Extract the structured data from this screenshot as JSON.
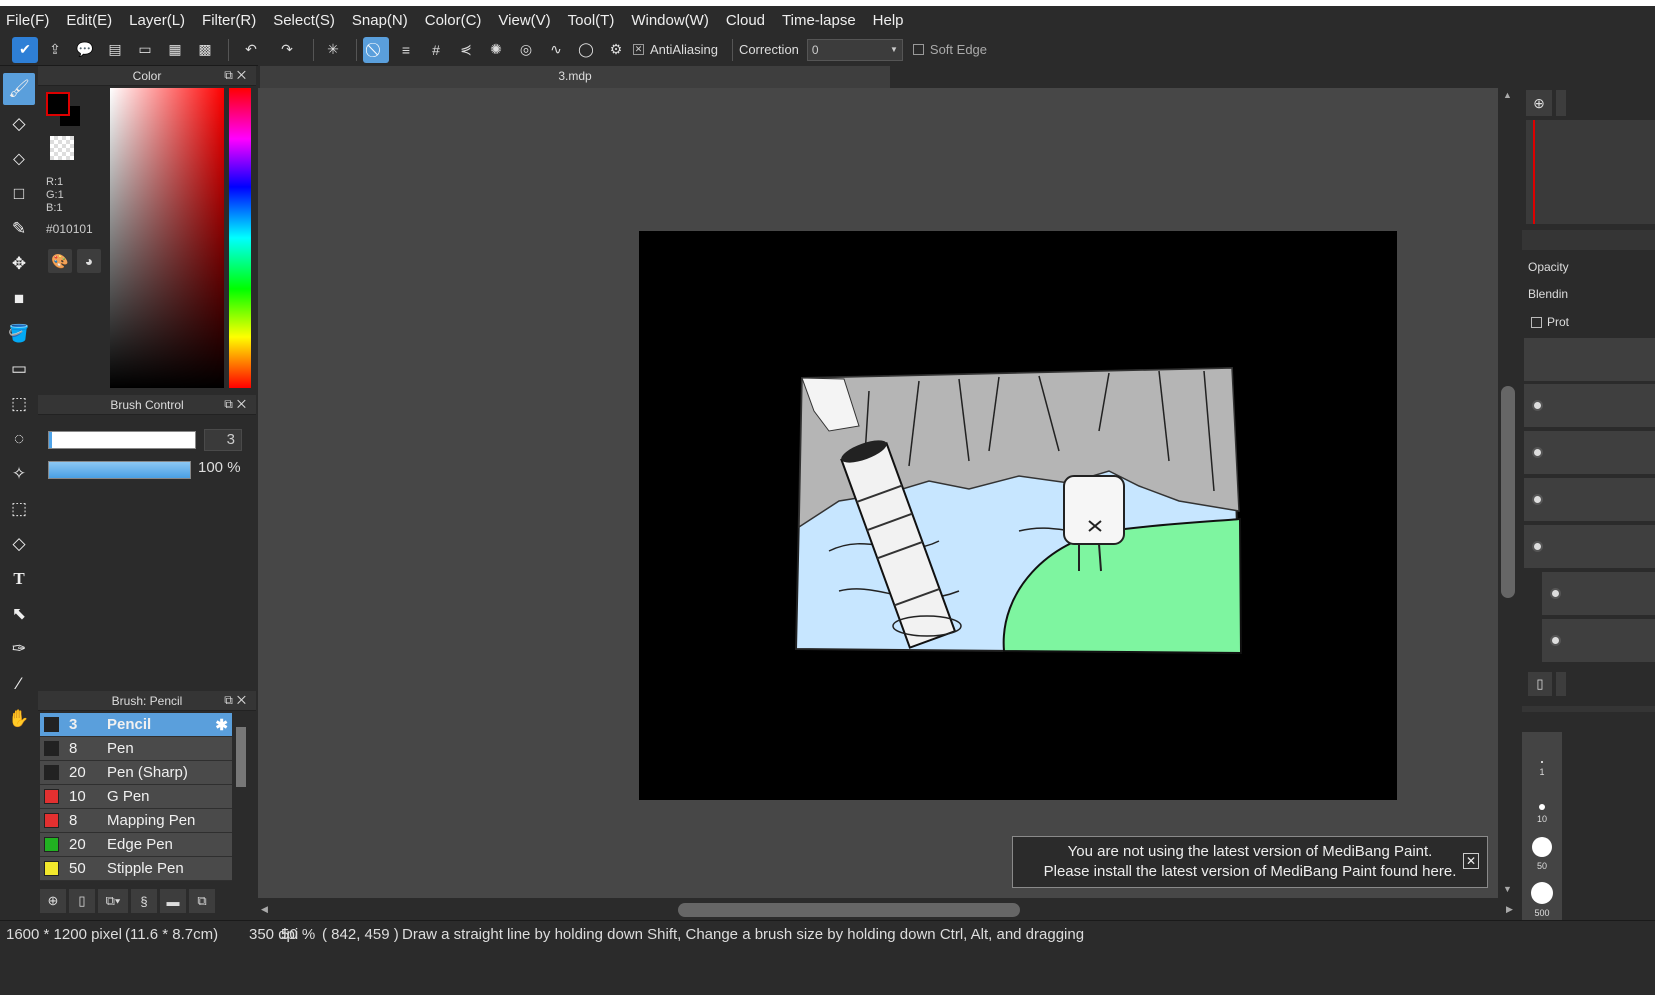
{
  "menu": [
    "File(F)",
    "Edit(E)",
    "Layer(L)",
    "Filter(R)",
    "Select(S)",
    "Snap(N)",
    "Color(C)",
    "View(V)",
    "Tool(T)",
    "Window(W)",
    "Cloud",
    "Time-lapse",
    "Help"
  ],
  "toolbar": {
    "antialiasing_label": "AntiAliasing",
    "antialiasing_checked": true,
    "correction_label": "Correction",
    "correction_value": "0",
    "soft_edge_label": "Soft Edge",
    "soft_edge_checked": false
  },
  "color_panel": {
    "title": "Color",
    "r": "R:1",
    "g": "G:1",
    "b": "B:1",
    "hex": "#010101",
    "foreground": "#010101",
    "background": "#000000"
  },
  "brush_control": {
    "title": "Brush Control",
    "size_value": "3",
    "opacity_value": "100 %",
    "opacity_fraction": 1.0
  },
  "brush_panel": {
    "title": "Brush: Pencil",
    "brushes": [
      {
        "size": "3",
        "name": "Pencil",
        "color": "#222222",
        "selected": true
      },
      {
        "size": "8",
        "name": "Pen",
        "color": "#222222",
        "selected": false
      },
      {
        "size": "20",
        "name": "Pen (Sharp)",
        "color": "#222222",
        "selected": false
      },
      {
        "size": "10",
        "name": "G Pen",
        "color": "#e33030",
        "selected": false
      },
      {
        "size": "8",
        "name": "Mapping Pen",
        "color": "#e33030",
        "selected": false
      },
      {
        "size": "20",
        "name": "Edge Pen",
        "color": "#21b121",
        "selected": false
      },
      {
        "size": "50",
        "name": "Stipple Pen",
        "color": "#f2e82c",
        "selected": false
      }
    ]
  },
  "document": {
    "tab_title": "3.mdp"
  },
  "notice": {
    "line1": "You are not using the latest version of MediBang Paint.",
    "line2": "Please install the latest version of MediBang Paint found here."
  },
  "right_panel": {
    "opacity_label": "Opacity",
    "blending_label": "Blendin",
    "protect_label": "Prot",
    "brush_sizes": [
      "1",
      "10",
      "50",
      "500"
    ]
  },
  "status": {
    "size": "1600 * 1200 pixel",
    "physical": "(11.6 * 8.7cm)",
    "dpi": "350 dpi",
    "zoom": "50 %",
    "coords": "( 842, 459 )",
    "hint": "Draw a straight line by holding down Shift, Change a brush size by holding down Ctrl, Alt, and dragging"
  },
  "colors": {
    "accent": "#5a9fdc",
    "panel_bg": "#2b2b2b",
    "canvas_bg": "#474747",
    "water": "#c7e6ff",
    "grass": "#7ef5a0",
    "rock": "#b5b5b5"
  }
}
